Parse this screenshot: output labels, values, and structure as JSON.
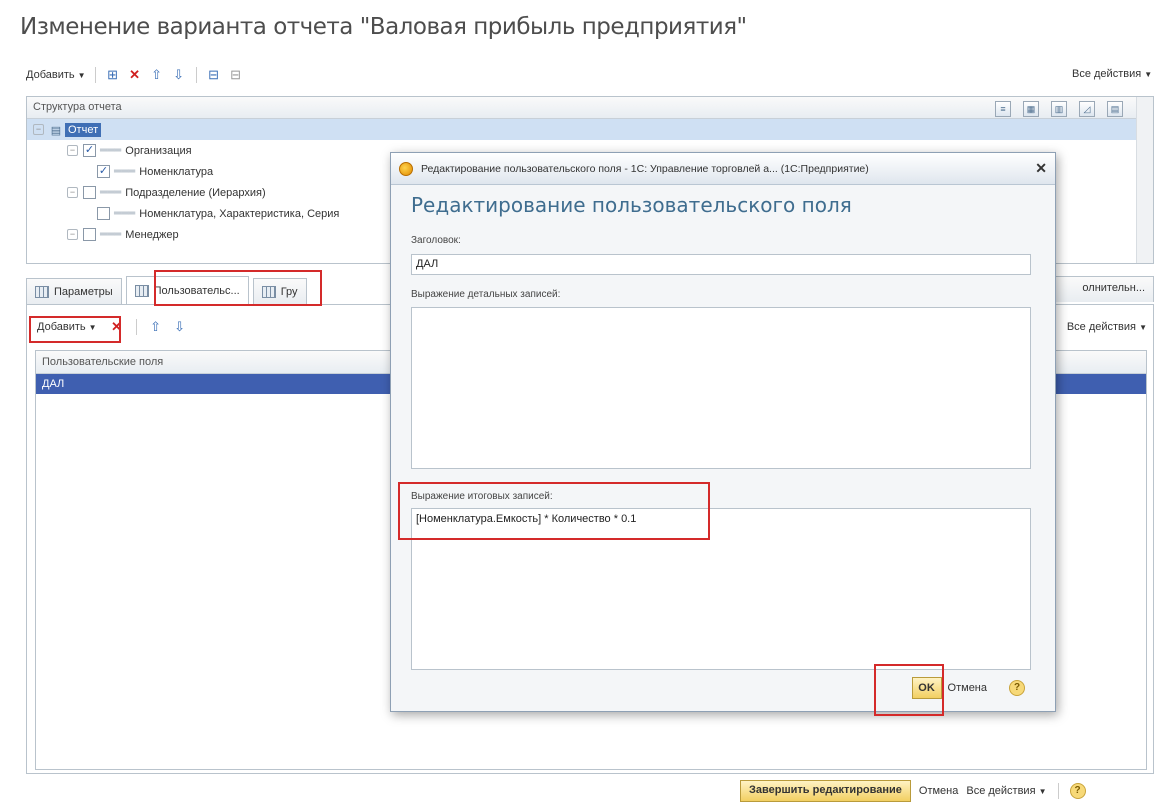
{
  "window": {
    "title": "Изменение варианта отчета \"Валовая прибыль предприятия\""
  },
  "toolbar": {
    "add_label": "Добавить",
    "all_actions": "Все действия"
  },
  "structure": {
    "header": "Структура отчета",
    "rows": [
      {
        "label": "Отчет",
        "selected": true
      },
      {
        "label": "Организация",
        "checked": true
      },
      {
        "label": "Номенклатура",
        "checked": true
      },
      {
        "label": "Подразделение (Иерархия)",
        "checked": false
      },
      {
        "label": "Номенклатура, Характеристика, Серия",
        "checked": false
      },
      {
        "label": "Менеджер",
        "checked": false
      }
    ]
  },
  "tabs": {
    "params": "Параметры",
    "user_fields": "Пользовательс...",
    "groups": "Гру",
    "extra": "олнительн..."
  },
  "panel": {
    "add_label": "Добавить",
    "all_actions": "Все действия",
    "list_header": "Пользовательские поля",
    "rows": [
      "ДАЛ"
    ]
  },
  "dialog": {
    "titlebar": "Редактирование пользовательского поля - 1С: Управление торговлей а... (1С:Предприятие)",
    "heading": "Редактирование пользовательского поля",
    "title_label": "Заголовок:",
    "title_value": "ДАЛ",
    "detail_label": "Выражение детальных записей:",
    "detail_value": "",
    "total_label": "Выражение итоговых записей:",
    "total_value": "[Номенклатура.Емкость] * Количество * 0.1",
    "ok_label": "OK",
    "cancel_label": "Отмена",
    "help": "?"
  },
  "bottom": {
    "finish_label": "Завершить редактирование",
    "cancel_label": "Отмена",
    "all_actions": "Все действия",
    "help": "?"
  }
}
